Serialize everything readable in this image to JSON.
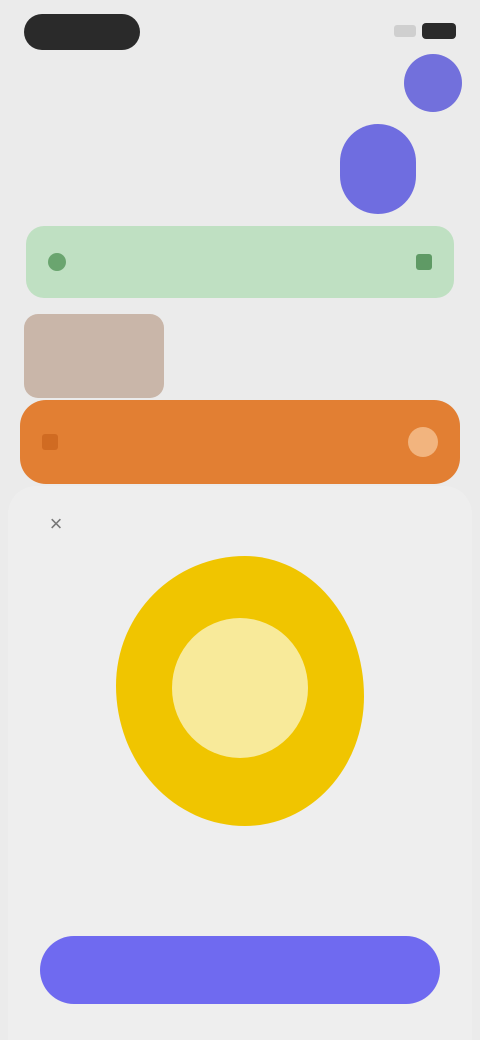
{
  "status_bar": {
    "left": "",
    "right": ""
  },
  "tabs": [
    {
      "label": ""
    },
    {
      "label": ""
    },
    {
      "label": ""
    }
  ],
  "green_banner": {
    "text": ""
  },
  "media_row": {
    "caption": ""
  },
  "orange_bar": {
    "label": ""
  },
  "sheet": {
    "title": "",
    "headline": "",
    "subtext": "",
    "cta_label": ""
  },
  "colors": {
    "accent": "#6f6af0",
    "green": "#bfe0c2",
    "orange": "#e27f33",
    "yellow": "#f0c500"
  }
}
